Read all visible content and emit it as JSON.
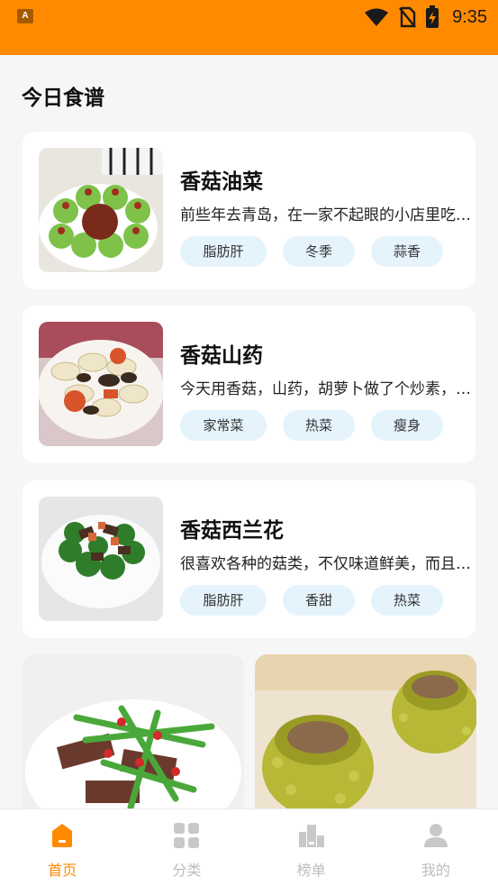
{
  "status_bar": {
    "app_badge": "A",
    "time": "9:35",
    "icons": [
      "app-notification-icon",
      "wifi-icon",
      "no-sim-icon",
      "battery-charging-icon"
    ]
  },
  "section": {
    "title": "今日食谱"
  },
  "recipes": [
    {
      "title": "香菇油菜",
      "desc": "前些年去青岛，在一家不起眼的小店里吃到这道菜",
      "tags": [
        "脂肪肝",
        "冬季",
        "蒜香"
      ],
      "image_icon": "dish-photo"
    },
    {
      "title": "香菇山药",
      "desc": "今天用香菇，山药，胡萝卜做了个炒素，清淡爽口",
      "tags": [
        "家常菜",
        "热菜",
        "瘦身"
      ],
      "image_icon": "dish-photo"
    },
    {
      "title": "香菇西兰花",
      "desc": "很喜欢各种的菇类，不仅味道鲜美，而且营养丰富",
      "tags": [
        "脂肪肝",
        "香甜",
        "热菜"
      ],
      "image_icon": "dish-photo"
    }
  ],
  "tab_bar": {
    "tabs": [
      {
        "label": "首页",
        "icon": "home-icon",
        "active": true
      },
      {
        "label": "分类",
        "icon": "grid-icon",
        "active": false
      },
      {
        "label": "榜单",
        "icon": "ranking-icon",
        "active": false
      },
      {
        "label": "我的",
        "icon": "user-icon",
        "active": false
      }
    ]
  },
  "colors": {
    "brand": "#ff8a00",
    "tag_bg": "#e5f3fd",
    "inactive_tab": "#bdbdbd"
  }
}
